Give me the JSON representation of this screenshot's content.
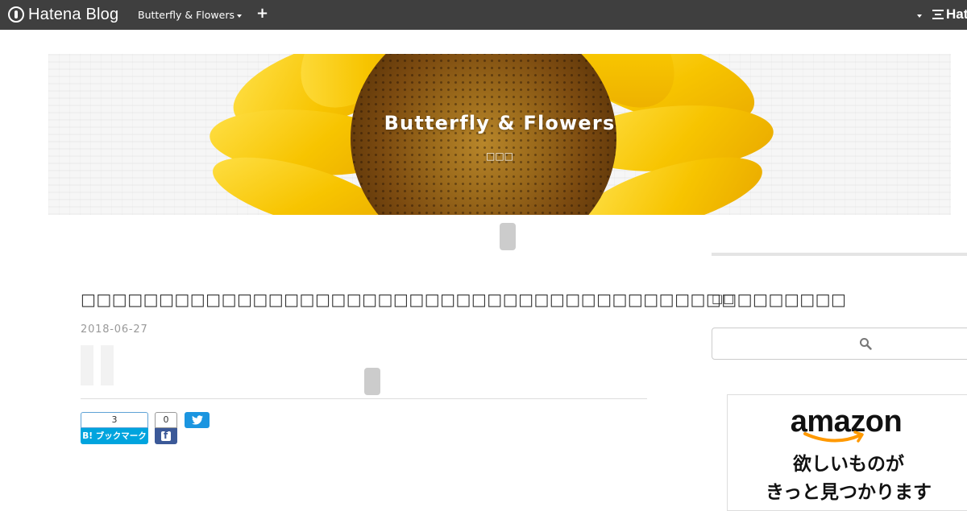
{
  "global_header": {
    "brand": "Hatena Blog",
    "blog_switcher": "Butterfly & Flowers",
    "add_label": "+",
    "right_brand": "Hat"
  },
  "blog_header": {
    "title": "Butterfly & Flowers",
    "description": "□□□"
  },
  "entry": {
    "title": "□□□□□□□□□□□□□□□□□□□□□□□□□□□□□□□□□□□□□□□□□□□□□□□□□",
    "date": "2018-06-27"
  },
  "share": {
    "hatena_count": "3",
    "hatena_label": "B! ブックマーク",
    "facebook_count": "0"
  },
  "sidebar": {
    "heading": "□□",
    "search_placeholder": ""
  },
  "ad": {
    "logo": "amazon",
    "line1": "欲しいものが",
    "line2": "きっと見つかります"
  },
  "colors": {
    "header_bg": "#3f3f3f",
    "hatena_blue": "#00a4de",
    "facebook_blue": "#3b5998",
    "twitter_blue": "#1b95e0",
    "amazon_orange": "#ff9900"
  }
}
